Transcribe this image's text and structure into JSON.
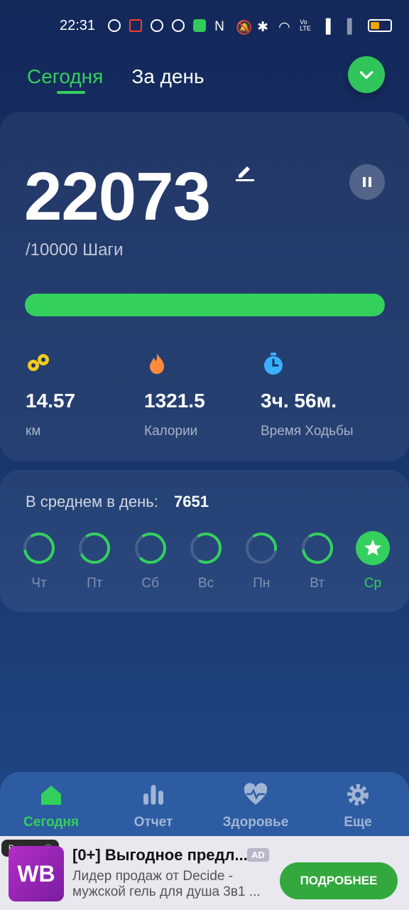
{
  "status_bar": {
    "time": "22:31",
    "icons": [
      "clock-icon",
      "app-icon",
      "route-icon",
      "flower-icon",
      "shield-icon",
      "nfc-icon",
      "mute-icon",
      "bluetooth-icon",
      "wifi-icon",
      "volte-icon",
      "signal-icon",
      "signal-x-icon",
      "battery-icon"
    ]
  },
  "header": {
    "tabs": [
      {
        "label": "Сегодня",
        "active": true
      },
      {
        "label": "За день",
        "active": false
      }
    ]
  },
  "steps": {
    "value": "22073",
    "goal_text": "/10000 Шаги",
    "progress": 1.0
  },
  "stats": [
    {
      "icon": "footprints-icon",
      "value": "14.57",
      "label": "км",
      "color": "#f2cc1d"
    },
    {
      "icon": "flame-icon",
      "value": "1321.5",
      "label": "Калории",
      "color": "#ff8a3d"
    },
    {
      "icon": "stopwatch-icon",
      "value": "3ч. 56м.",
      "label": "Время Ходьбы",
      "color": "#3ab0ff"
    }
  ],
  "average": {
    "label": "В среднем в день:",
    "value": "7651"
  },
  "week": [
    {
      "label": "Чт",
      "progress": 0.8
    },
    {
      "label": "Пт",
      "progress": 0.75
    },
    {
      "label": "Сб",
      "progress": 0.7
    },
    {
      "label": "Вс",
      "progress": 0.65
    },
    {
      "label": "Пн",
      "progress": 0.35
    },
    {
      "label": "Вт",
      "progress": 0.8
    },
    {
      "label": "Ср",
      "progress": 1.0,
      "today": true
    }
  ],
  "bottom_nav": [
    {
      "label": "Сегодня",
      "icon": "home-icon",
      "active": true
    },
    {
      "label": "Отчет",
      "icon": "bar-chart-icon",
      "active": false
    },
    {
      "label": "Здоровье",
      "icon": "heart-pulse-icon",
      "active": false
    },
    {
      "label": "Еще",
      "icon": "gear-icon",
      "active": false
    }
  ],
  "ad": {
    "tag": "Реклама",
    "logo": "WB",
    "title": "[0+] Выгодное предл...",
    "badge": "AD",
    "description": "Лидер продаж от Decide - мужской гель для душа 3в1 ...",
    "cta": "ПОДРОБНЕЕ"
  },
  "colors": {
    "accent": "#33d05e",
    "background": "#183468"
  }
}
